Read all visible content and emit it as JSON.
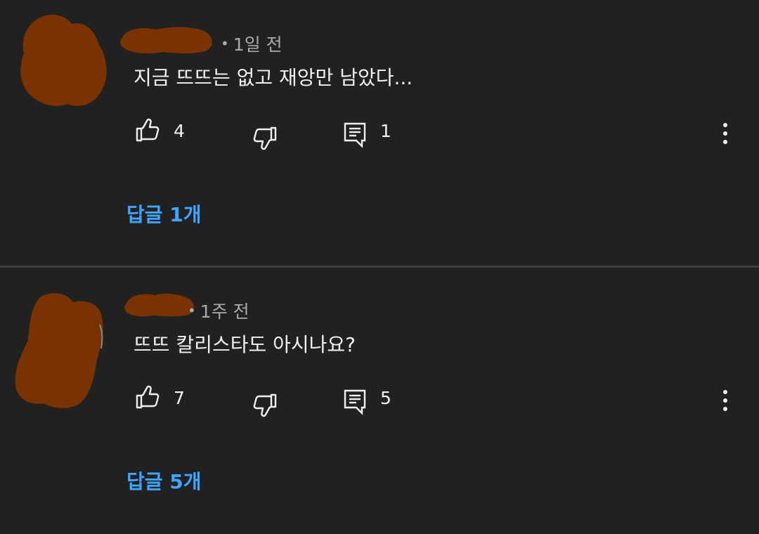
{
  "colors": {
    "background": "#212121",
    "divider": "#3d3d3d",
    "text": "#f1f1f1",
    "meta": "#aaaaaa",
    "link": "#3ea6ff",
    "redaction": "#7a3300"
  },
  "icons": {
    "like": "thumbs-up-outline",
    "dislike": "thumbs-down-outline",
    "reply": "comment-outline",
    "more": "vertical-ellipsis"
  },
  "comments": [
    {
      "time": "1일 전",
      "text": "지금 뜨뜨는 없고 재앙만 남았다...",
      "likes": "4",
      "reply_count": "1",
      "replies_link": "답글 1개"
    },
    {
      "time": "1주 전",
      "text": "뜨뜨 칼리스타도 아시나요?",
      "likes": "7",
      "reply_count": "5",
      "replies_link": "답글 5개"
    }
  ]
}
